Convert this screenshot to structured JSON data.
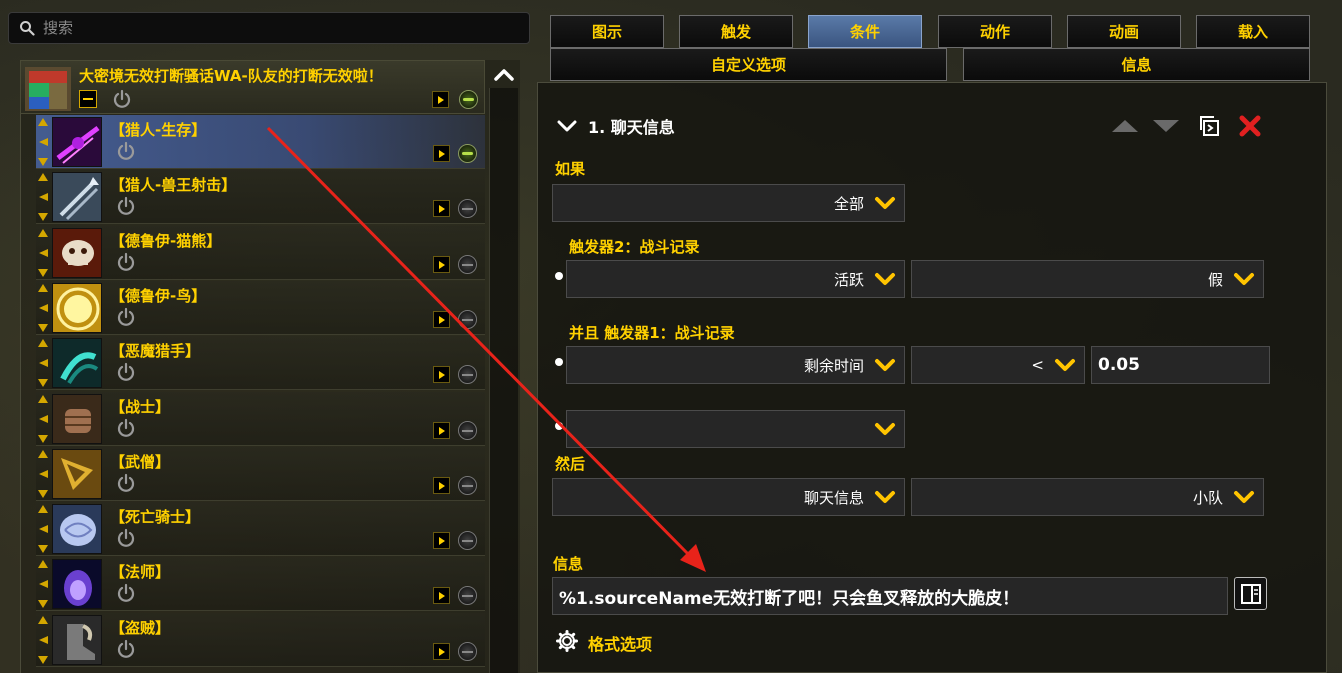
{
  "search": {
    "placeholder": "搜索"
  },
  "group": {
    "title": "大密境无效打断骚话WA-队友的打断无效啦！"
  },
  "auras": [
    {
      "name": "【猎人-生存】",
      "selected": true,
      "visible": true,
      "icon": "purple-slash-icon"
    },
    {
      "name": "【猎人-兽王射击】",
      "selected": false,
      "visible": false,
      "icon": "arrow-volley-icon"
    },
    {
      "name": "【德鲁伊-猫熊】",
      "selected": false,
      "visible": false,
      "icon": "bear-skull-icon"
    },
    {
      "name": "【德鲁伊-鸟】",
      "selected": false,
      "visible": false,
      "icon": "sun-icon"
    },
    {
      "name": "【恶魔猎手】",
      "selected": false,
      "visible": false,
      "icon": "demon-claw-icon"
    },
    {
      "name": "【战士】",
      "selected": false,
      "visible": false,
      "icon": "fist-icon"
    },
    {
      "name": "【武僧】",
      "selected": false,
      "visible": false,
      "icon": "spear-hand-icon"
    },
    {
      "name": "【死亡骑士】",
      "selected": false,
      "visible": false,
      "icon": "frost-brain-icon"
    },
    {
      "name": "【法师】",
      "selected": false,
      "visible": false,
      "icon": "arcane-orb-icon"
    },
    {
      "name": "【盗贼】",
      "selected": false,
      "visible": false,
      "icon": "boot-kick-icon"
    }
  ],
  "tabs": {
    "row1": [
      "图示",
      "触发",
      "条件",
      "动作",
      "动画",
      "载入"
    ],
    "active": "条件",
    "custom_options": "自定义选项",
    "info": "信息"
  },
  "condition": {
    "title": "1. 聊天信息",
    "if_label": "如果",
    "if_value": "全部",
    "trigger2_label": "触发器2：战斗记录",
    "trigger2_field": "活跃",
    "trigger2_value": "假",
    "trigger1_label": "并且 触发器1：战斗记录",
    "trigger1_field": "剩余时间",
    "trigger1_op": "<",
    "trigger1_value": "0.05",
    "then_label": "然后",
    "then_action": "聊天信息",
    "then_channel": "小队",
    "message_label": "信息",
    "message_value": "%1.sourceName无效打断了吧！只会鱼叉释放的大脆皮！",
    "format_options": "格式选项"
  },
  "colors": {
    "accent": "#ffd100",
    "active_tab": "#4a6a98",
    "delete": "#e02020",
    "annotation_arrow": "#e8231a"
  }
}
